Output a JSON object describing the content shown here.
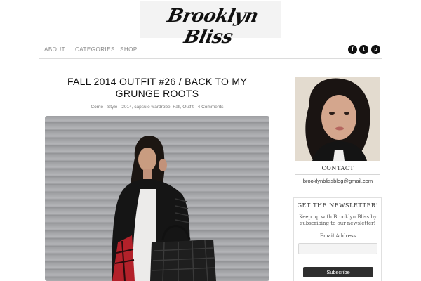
{
  "site": {
    "logo_text": "Brooklyn Bliss"
  },
  "nav": {
    "items": [
      {
        "label": "ABOUT"
      },
      {
        "label": "CATEGORIES"
      },
      {
        "label": "SHOP"
      }
    ],
    "social": [
      {
        "icon": "facebook-icon",
        "glyph": "f"
      },
      {
        "icon": "twitter-icon",
        "glyph": "t"
      },
      {
        "icon": "pinterest-icon",
        "glyph": "p"
      }
    ]
  },
  "post": {
    "title": "FALL 2014 OUTFIT #26 / BACK TO MY GRUNGE ROOTS",
    "meta": {
      "author": "Corrie",
      "section": "Style",
      "tags": "2014, capsule wardrobe, Fall, Outfit",
      "comments": "4 Comments"
    }
  },
  "sidebar": {
    "contact_heading": "CONTACT",
    "email": "brooklynblissblog@gmail.com",
    "newsletter_heading": "GET THE NEWSLETTER!",
    "newsletter_text": "Keep up with Brooklyn Bliss by subscribing to our newsletter!",
    "email_label": "Email Address",
    "email_value": "",
    "subscribe_label": "Subscribe"
  },
  "colors": {
    "accent": "#111111",
    "nav_text": "#8a8a8a",
    "button_bg": "#2f2f2f"
  }
}
